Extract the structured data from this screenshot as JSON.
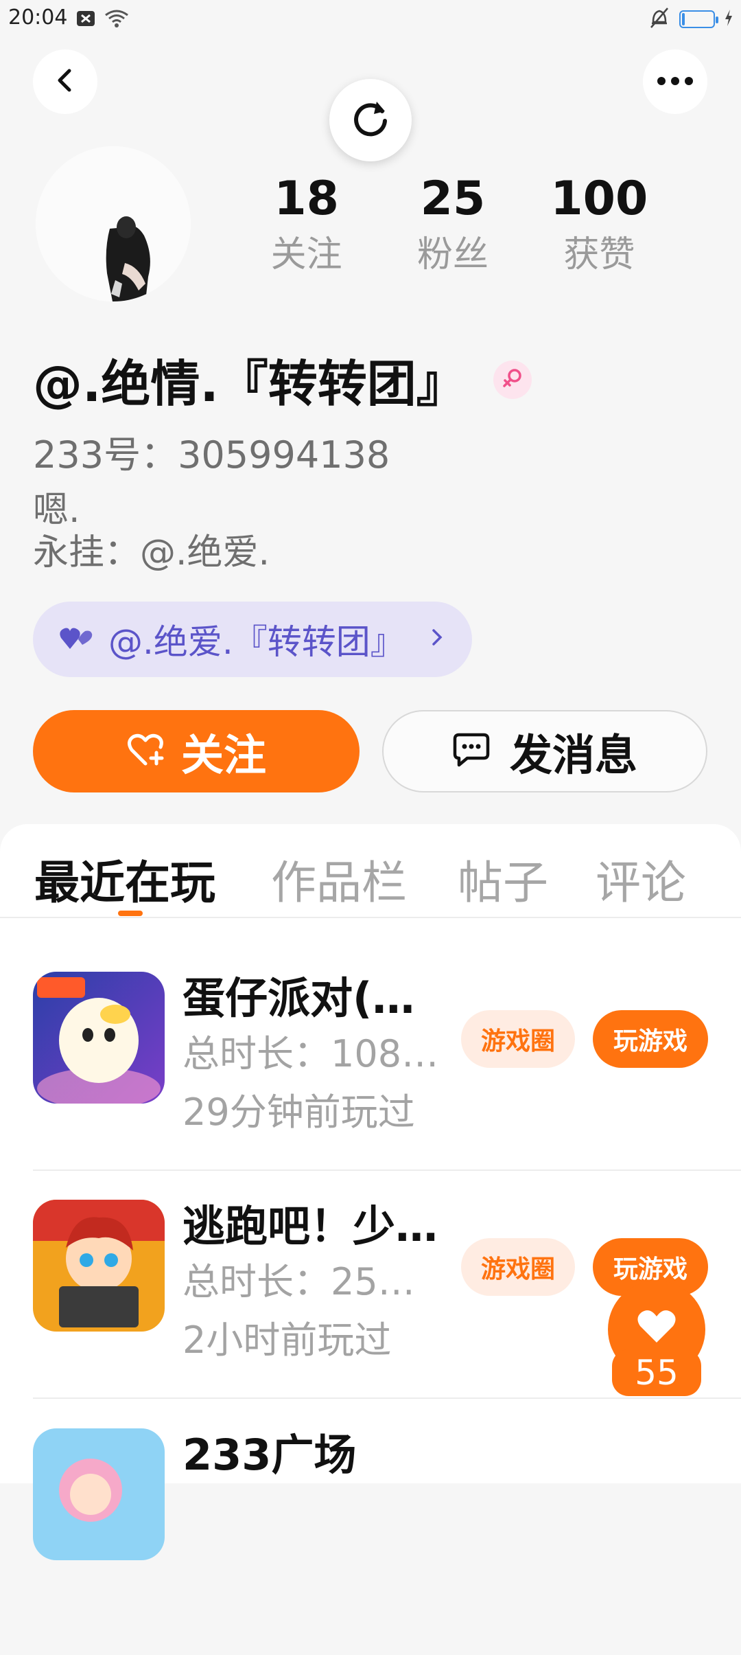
{
  "status_bar": {
    "time": "20:04"
  },
  "profile": {
    "stats": [
      {
        "value": "18",
        "label": "关注"
      },
      {
        "value": "25",
        "label": "粉丝"
      },
      {
        "value": "100",
        "label": "获赞"
      }
    ],
    "username": "@.绝情.『转转团』",
    "user_id": "233号：305994138",
    "bio_lines": [
      "嗯.",
      "永挂：@.绝爱."
    ],
    "partner_name": "@.绝爱.『转转团』",
    "follow_label": "关注",
    "message_label": "发消息"
  },
  "tabs": [
    "最近在玩",
    "作品栏",
    "帖子",
    "评论"
  ],
  "games": [
    {
      "name": "蛋仔派对(…",
      "duration": "总时长：108…",
      "last_played": "29分钟前玩过",
      "circle_label": "游戏圈",
      "play_label": "玩游戏"
    },
    {
      "name": "逃跑吧！少…",
      "duration": "总时长：25…",
      "last_played": "2小时前玩过",
      "circle_label": "游戏圈",
      "play_label": "玩游戏"
    },
    {
      "name": "233广场",
      "duration": "",
      "last_played": "",
      "circle_label": "",
      "play_label": ""
    }
  ],
  "like_fab": {
    "count": "55"
  },
  "colors": {
    "accent": "#ff7310",
    "partner_text": "#5b54c9",
    "partner_bg": "#e6e3f7"
  }
}
